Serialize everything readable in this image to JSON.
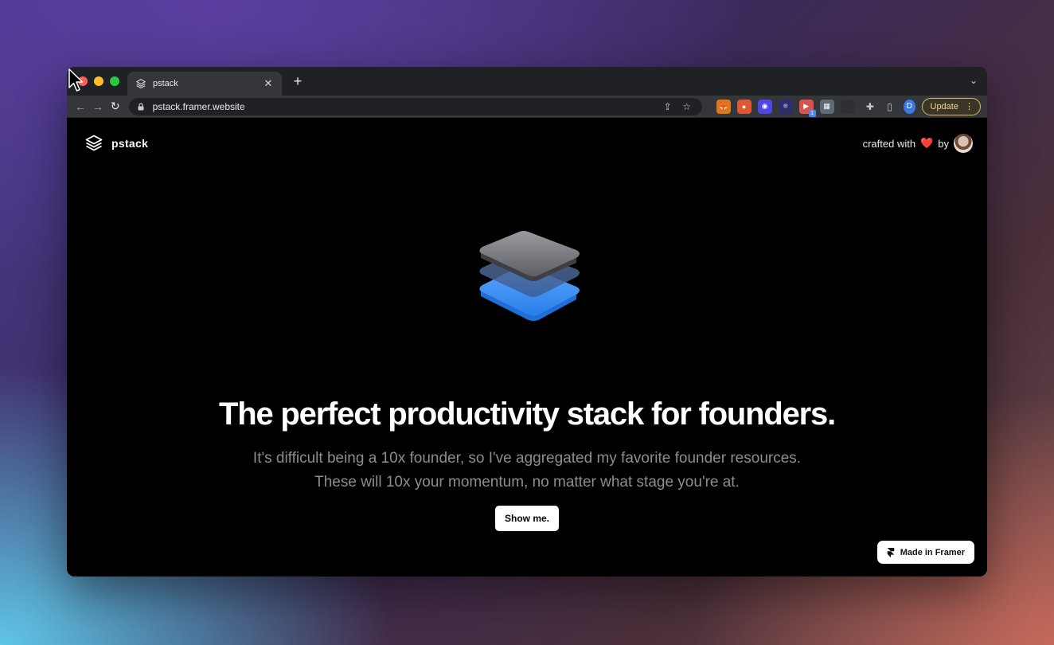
{
  "browser": {
    "tab": {
      "title": "pstack"
    },
    "new_tab_label": "+",
    "address_bar": {
      "url": "pstack.framer.website"
    },
    "extensions": [
      {
        "name": "metamask-extension",
        "color": "#e2761b",
        "glyph": "🦊"
      },
      {
        "name": "duckduckgo-extension",
        "color": "#de5833",
        "glyph": "●"
      },
      {
        "name": "chat-extension",
        "color": "#4f46e5",
        "glyph": "◉"
      },
      {
        "name": "react-devtools-extension",
        "color": "#2a2d6e",
        "glyph": "⚛"
      },
      {
        "name": "camera-extension",
        "color": "#d9534f",
        "glyph": "▶",
        "badge": "1"
      },
      {
        "name": "grid-extension",
        "color": "#5c6a7a",
        "glyph": "▦"
      },
      {
        "name": "hidden-extension",
        "color": "#2f3033",
        "glyph": ""
      }
    ],
    "profile_initial": "D",
    "update_label": "Update"
  },
  "page": {
    "logo_name": "pstack",
    "credit": {
      "prefix": "crafted with",
      "heart": "❤️",
      "suffix": "by"
    },
    "headline": "The perfect productivity stack for founders.",
    "subheadline": "It's difficult being a 10x founder, so I've aggregated my favorite founder resources. These will 10x your momentum, no matter what stage you're at.",
    "cta_label": "Show me.",
    "badge_label": "Made in Framer"
  },
  "colors": {
    "accent_blue": "#3f95ff",
    "update_border": "#d8b860"
  }
}
